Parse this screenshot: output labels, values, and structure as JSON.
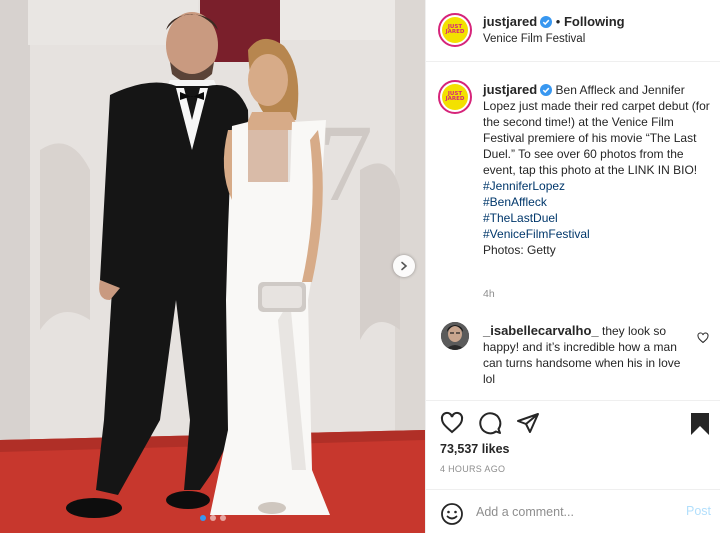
{
  "colors": {
    "brand_pink": "#d6247a",
    "brand_yellow": "#f3e100",
    "link_blue": "#00376b",
    "verified_blue": "#3897f0",
    "carpet_red": "#c7372d"
  },
  "header": {
    "username": "justjared",
    "separator": " • ",
    "follow_status": "Following",
    "location": "Venice Film Festival",
    "avatar_text_line1": "JUST",
    "avatar_text_line2": "JARED"
  },
  "caption": {
    "username": "justjared",
    "text": "Ben Affleck and Jennifer Lopez just made their red carpet debut (for the second time!) at the Venice Film Festival premiere of his movie “The Last Duel.” To see over 60 photos from the event, tap this photo at the LINK IN BIO!",
    "hashtags": [
      "#JenniferLopez",
      "#BenAffleck",
      "#TheLastDuel",
      "#VeniceFilmFestival"
    ],
    "credit": "Photos: Getty",
    "time": "4h"
  },
  "comment": {
    "username": "_isabellecarvalho_",
    "text": "they look so happy! and it’s incredible how a man can turns handsome when his in love lol"
  },
  "actions": {
    "icons": [
      "heart-icon",
      "comment-icon",
      "share-icon",
      "bookmark-icon"
    ],
    "likes": "73,537 likes",
    "posted": "4 HOURS AGO"
  },
  "composer": {
    "placeholder": "Add a comment...",
    "post_label": "Post",
    "emoji_icon": "emoji-icon"
  },
  "carousel": {
    "slides": 3,
    "active_slide": 1,
    "next_icon": "chevron-right-icon"
  }
}
